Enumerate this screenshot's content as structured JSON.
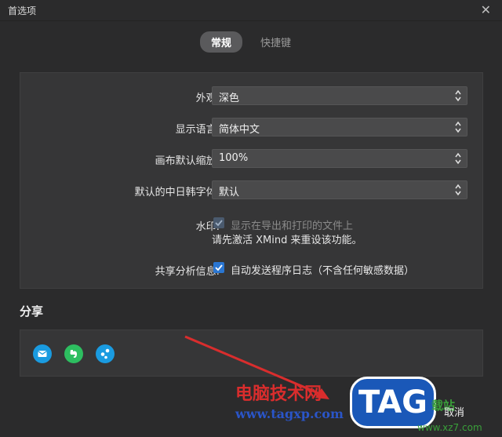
{
  "window": {
    "title": "首选项",
    "close_glyph": "✕"
  },
  "tabs": [
    {
      "label": "常规",
      "active": true
    },
    {
      "label": "快捷键",
      "active": false
    }
  ],
  "general": {
    "appearance": {
      "label": "外观:",
      "value": "深色"
    },
    "language": {
      "label": "显示语言:",
      "value": "简体中文"
    },
    "zoom": {
      "label": "画布默认缩放:",
      "value": "100%"
    },
    "cjk_font": {
      "label": "默认的中日韩字体:",
      "value": "默认"
    },
    "watermark": {
      "label": "水印:",
      "checkbox_text": "显示在导出和打印的文件上",
      "checked": true,
      "disabled": true,
      "note": "请先激活 XMind 来重设该功能。"
    },
    "analytics": {
      "label": "共享分析信息:",
      "checkbox_text": "自动发送程序日志（不含任何敏感数据）",
      "checked": true
    }
  },
  "share": {
    "title": "分享",
    "icons": [
      "mail-icon",
      "evernote-icon",
      "share-network-icon"
    ],
    "colors": {
      "mail": "#1a9be0",
      "evernote": "#2dbe60",
      "other": "#1a9be0"
    }
  },
  "footer": {
    "cancel_label": "取消"
  },
  "overlay": {
    "site_name": "电脑技术网",
    "site_url": "www.tagxp.com",
    "tag": "TAG",
    "side_text": "载站",
    "side_url": "www.xz7.com"
  }
}
